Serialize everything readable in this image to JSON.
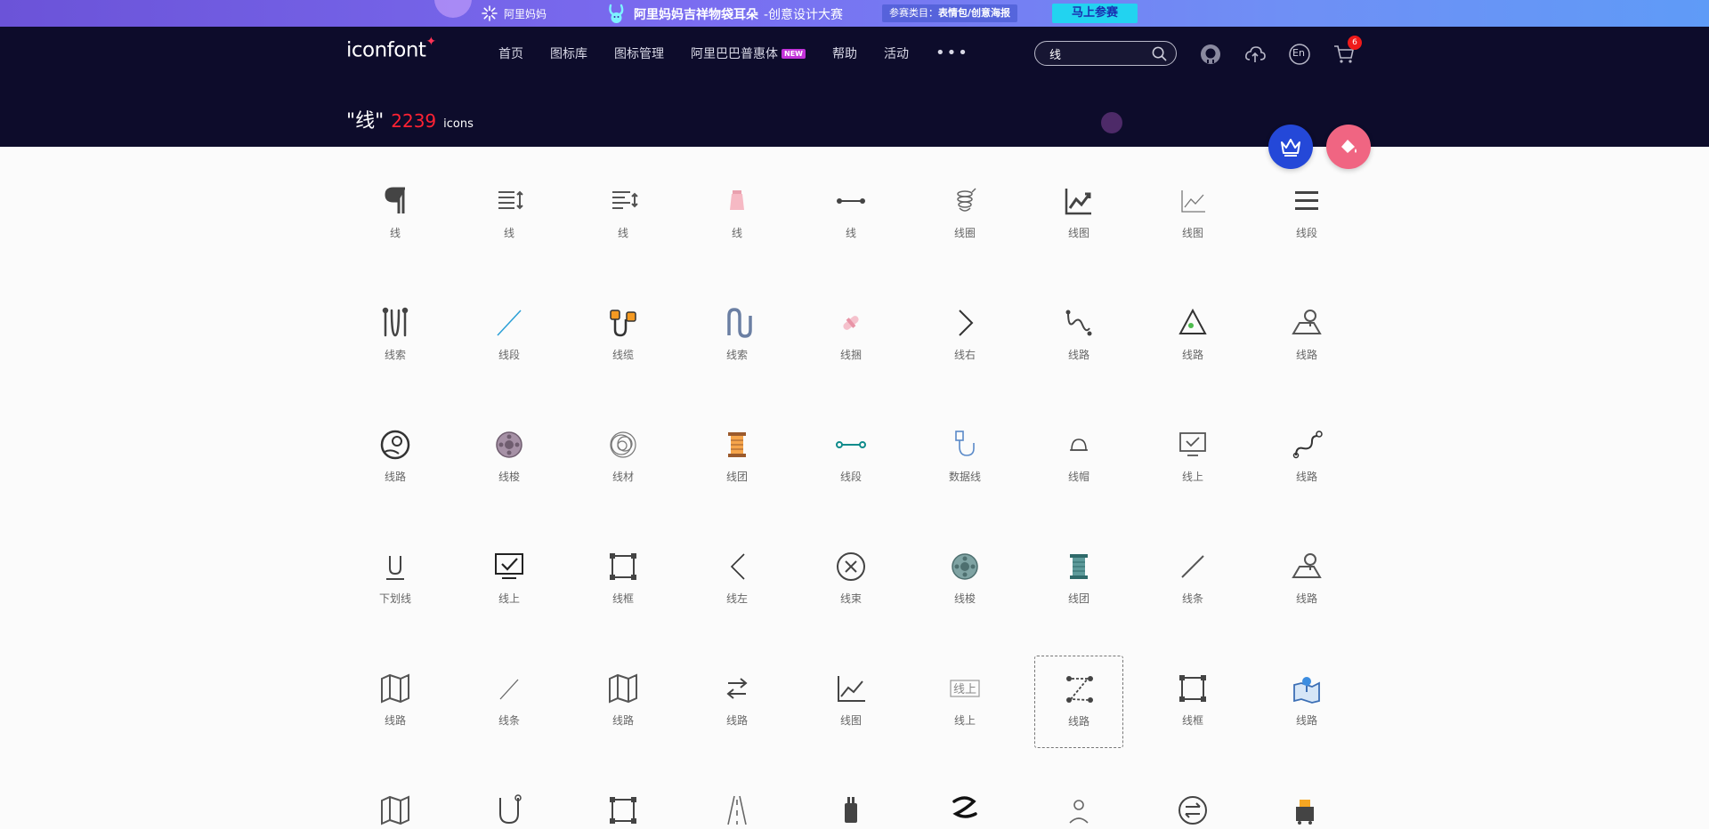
{
  "banner": {
    "logo_text": "阿里妈妈",
    "campaign_title": "阿里妈妈吉祥物袋耳朵",
    "campaign_sub": "-创意设计大赛",
    "category_label": "参赛类目：",
    "category_value": "表情包/创意海报",
    "cta": "马上参赛"
  },
  "header": {
    "brand": "iconfont",
    "nav": [
      "首页",
      "图标库",
      "图标管理",
      "阿里巴巴普惠体",
      "帮助",
      "活动"
    ],
    "new_badge": "NEW",
    "more": "•••",
    "search_value": "线",
    "lang": "En",
    "cart_count": "6",
    "result_query": "\"线\"",
    "result_count": "2239",
    "result_unit": "icons"
  },
  "icons": [
    {
      "label": "线",
      "icon": "paragraph-icon"
    },
    {
      "label": "线",
      "icon": "line-spacing-icon"
    },
    {
      "label": "线",
      "icon": "line-height-icon"
    },
    {
      "label": "线",
      "icon": "thread-spool-pink-icon"
    },
    {
      "label": "线",
      "icon": "line-segment-icon"
    },
    {
      "label": "线圈",
      "icon": "coil-icon"
    },
    {
      "label": "线图",
      "icon": "line-chart-icon"
    },
    {
      "label": "线图",
      "icon": "line-chart-thin-icon"
    },
    {
      "label": "线段",
      "icon": "menu-lines-icon"
    },
    {
      "label": "线索",
      "icon": "wavy-lines-icon"
    },
    {
      "label": "线段",
      "icon": "diagonal-line-icon"
    },
    {
      "label": "线缆",
      "icon": "cable-icon"
    },
    {
      "label": "线索",
      "icon": "loop-path-icon"
    },
    {
      "label": "线捆",
      "icon": "bundle-icon"
    },
    {
      "label": "线右",
      "icon": "chevron-right-icon"
    },
    {
      "label": "线路",
      "icon": "squiggle-path-icon"
    },
    {
      "label": "线路",
      "icon": "triangle-route-icon"
    },
    {
      "label": "线路",
      "icon": "map-pin-icon"
    },
    {
      "label": "线路",
      "icon": "route-circle-icon"
    },
    {
      "label": "线梭",
      "icon": "thread-ball-icon"
    },
    {
      "label": "线材",
      "icon": "wire-coil-icon"
    },
    {
      "label": "线团",
      "icon": "spool-icon"
    },
    {
      "label": "线段",
      "icon": "segment-teal-icon"
    },
    {
      "label": "数据线",
      "icon": "usb-cable-icon"
    },
    {
      "label": "线帽",
      "icon": "wire-cap-icon"
    },
    {
      "label": "线上",
      "icon": "monitor-check-icon"
    },
    {
      "label": "线路",
      "icon": "route-path-icon"
    },
    {
      "label": "下划线",
      "icon": "underline-icon"
    },
    {
      "label": "线上",
      "icon": "online-check-icon"
    },
    {
      "label": "线框",
      "icon": "wireframe-icon"
    },
    {
      "label": "线左",
      "icon": "chevron-left-icon"
    },
    {
      "label": "线束",
      "icon": "close-circle-icon"
    },
    {
      "label": "线梭",
      "icon": "thread-ball-teal-icon"
    },
    {
      "label": "线团",
      "icon": "spool-teal-icon"
    },
    {
      "label": "线条",
      "icon": "slash-line-icon"
    },
    {
      "label": "线路",
      "icon": "map-pin-icon"
    },
    {
      "label": "线路",
      "icon": "folded-map-icon"
    },
    {
      "label": "线条",
      "icon": "thin-slash-icon"
    },
    {
      "label": "线路",
      "icon": "folded-map-icon"
    },
    {
      "label": "线路",
      "icon": "swap-arrows-icon"
    },
    {
      "label": "线图",
      "icon": "line-chart-axis-icon"
    },
    {
      "label": "线上",
      "icon": "online-text-icon"
    },
    {
      "label": "线路",
      "icon": "z-route-icon"
    },
    {
      "label": "线框",
      "icon": "wireframe-icon"
    },
    {
      "label": "线路",
      "icon": "map-location-icon"
    },
    {
      "label": "",
      "icon": "folded-map-icon"
    },
    {
      "label": "",
      "icon": "u-path-icon"
    },
    {
      "label": "",
      "icon": "wireframe-icon"
    },
    {
      "label": "",
      "icon": "road-icon"
    },
    {
      "label": "",
      "icon": "plug-icon"
    },
    {
      "label": "",
      "icon": "squiggle-bold-icon"
    },
    {
      "label": "",
      "icon": "person-route-icon"
    },
    {
      "label": "",
      "icon": "swap-circle-icon"
    },
    {
      "label": "",
      "icon": "delivery-icon"
    }
  ],
  "selected_index": 42,
  "colors": {
    "header_bg": "#0d0c2b",
    "accent_red": "#ff2233",
    "crown_fab": "#2448d8",
    "paint_fab": "#f06582"
  }
}
